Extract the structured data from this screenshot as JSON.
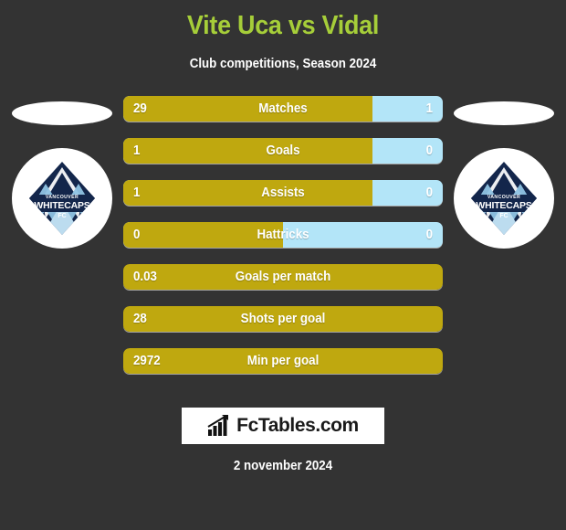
{
  "header": {
    "title": "Vite Uca vs Vidal",
    "subtitle": "Club competitions, Season 2024",
    "title_color": "#a6ce39"
  },
  "colors": {
    "background": "#333333",
    "left_bar": "#bfa80f",
    "right_bar": "#b3e5f8",
    "text": "#ffffff"
  },
  "crests": {
    "left": {
      "icon": "vancouver-whitecaps-fc-crest",
      "club_line1": "VANCOUVER",
      "club_line2": "WHITECAPS",
      "club_line3": "FC"
    },
    "right": {
      "icon": "vancouver-whitecaps-fc-crest",
      "club_line1": "VANCOUVER",
      "club_line2": "WHITECAPS",
      "club_line3": "FC"
    }
  },
  "stats": [
    {
      "label": "Matches",
      "left": "29",
      "right": "1",
      "left_pct": 78,
      "split": true
    },
    {
      "label": "Goals",
      "left": "1",
      "right": "0",
      "left_pct": 78,
      "split": true
    },
    {
      "label": "Assists",
      "left": "1",
      "right": "0",
      "left_pct": 78,
      "split": true
    },
    {
      "label": "Hattricks",
      "left": "0",
      "right": "0",
      "left_pct": 50,
      "split": true
    },
    {
      "label": "Goals per match",
      "left": "0.03",
      "right": "",
      "left_pct": 100,
      "split": false
    },
    {
      "label": "Shots per goal",
      "left": "28",
      "right": "",
      "left_pct": 100,
      "split": false
    },
    {
      "label": "Min per goal",
      "left": "2972",
      "right": "",
      "left_pct": 100,
      "split": false
    }
  ],
  "footer": {
    "brand": "FcTables.com",
    "brand_icon": "bar-chart-growth-icon",
    "date": "2 november 2024"
  },
  "chart_data": {
    "type": "bar",
    "title": "Vite Uca vs Vidal",
    "subtitle": "Club competitions, Season 2024",
    "categories": [
      "Matches",
      "Goals",
      "Assists",
      "Hattricks",
      "Goals per match",
      "Shots per goal",
      "Min per goal"
    ],
    "series": [
      {
        "name": "Vite Uca",
        "color": "#bfa80f",
        "values": [
          29,
          1,
          1,
          0,
          0.03,
          28,
          2972
        ]
      },
      {
        "name": "Vidal",
        "color": "#b3e5f8",
        "values": [
          1,
          0,
          0,
          0,
          null,
          null,
          null
        ]
      }
    ],
    "orientation": "horizontal-diverging",
    "grid": false,
    "legend": "none"
  }
}
